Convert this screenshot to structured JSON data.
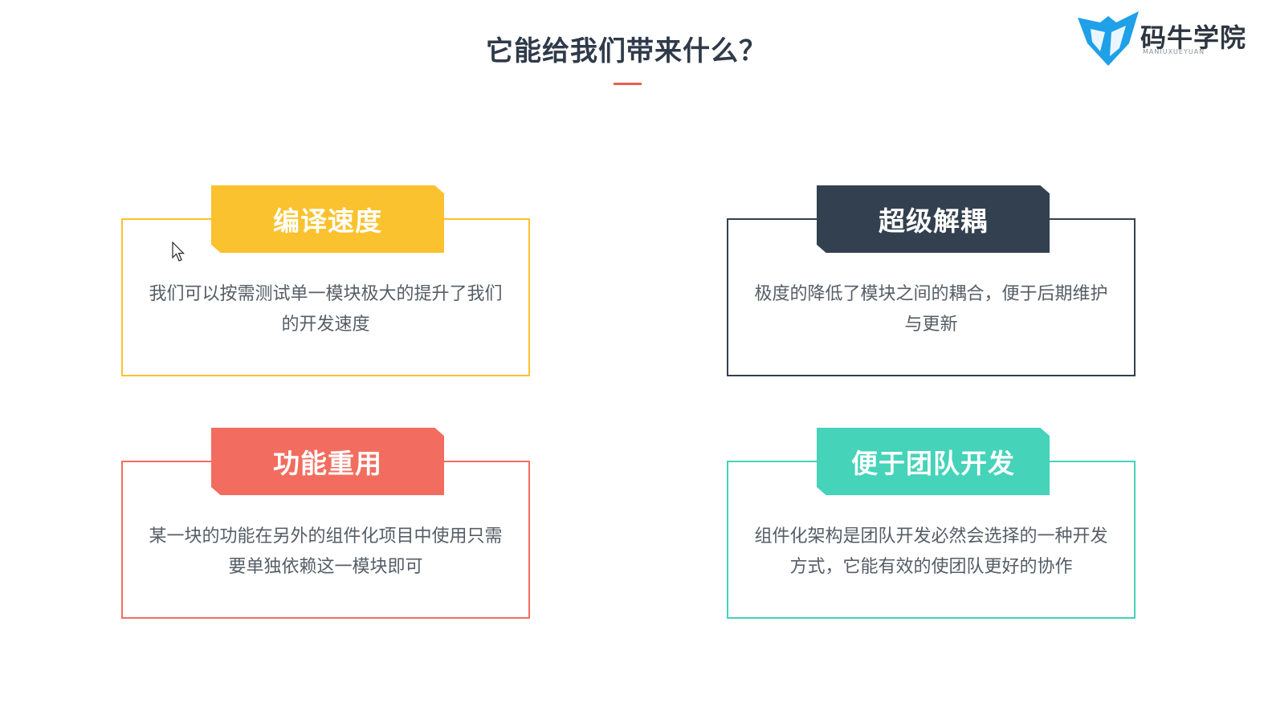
{
  "slide": {
    "title": "它能给我们带来什么？"
  },
  "logo": {
    "name": "码牛学院",
    "subtitle": "MANIUXUEYUAN",
    "colors": {
      "mark": "#1fa0e8",
      "text": "#2e3640"
    }
  },
  "cards": [
    {
      "heading": "编译速度",
      "body": "我们可以按需测试单一模块极大的提升了我们的开发速度",
      "color": "#fbc22f"
    },
    {
      "heading": "超级解耦",
      "body": "极度的降低了模块之间的耦合，便于后期维护与更新",
      "color": "#33404f"
    },
    {
      "heading": "功能重用",
      "body": "某一块的功能在另外的组件化项目中使用只需要单独依赖这一模块即可",
      "color": "#f26d5f"
    },
    {
      "heading": "便于团队开发",
      "body": "组件化架构是团队开发必然会选择的一种开发方式，它能有效的使团队更好的协作",
      "color": "#45d3b9"
    }
  ],
  "accent_color": "#e8604a",
  "cursor": {
    "icon": "arrow-cursor-icon"
  }
}
